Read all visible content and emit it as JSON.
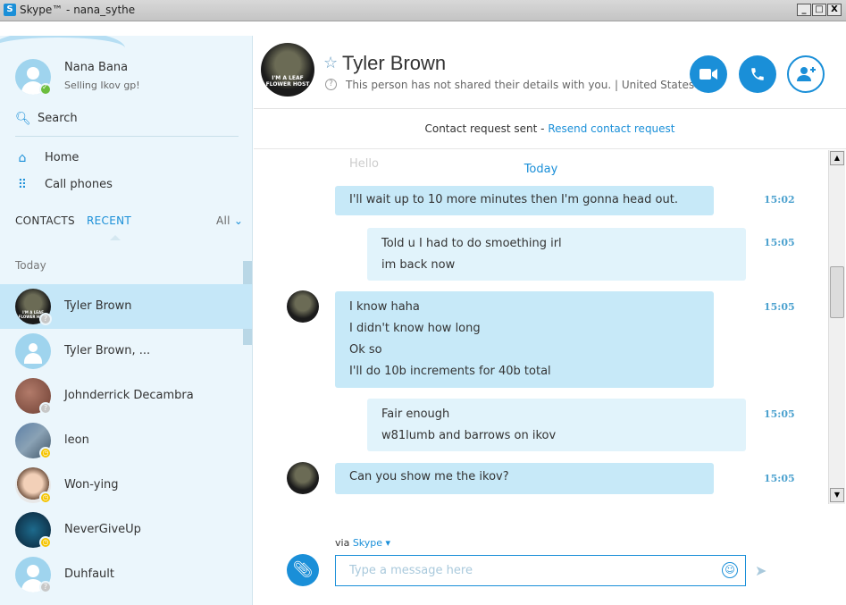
{
  "window": {
    "title": "Skype™ - nana_sythe",
    "logo": "S",
    "buttons": {
      "minimize": "_",
      "maximize": "□",
      "close": "X"
    }
  },
  "profile": {
    "name": "Nana Bana",
    "mood": "Selling Ikov gp!",
    "status_color": "#6cbd3d"
  },
  "sidebar": {
    "search_label": "Search",
    "nav": [
      {
        "label": "Home",
        "icon": "home-icon",
        "glyph": "⌂"
      },
      {
        "label": "Call phones",
        "icon": "dialpad-icon",
        "glyph": "⠿"
      }
    ],
    "tabs": {
      "contacts": "CONTACTS",
      "recent": "RECENT",
      "all": "All",
      "all_chevron": "⌄"
    },
    "section": "Today",
    "recent": [
      {
        "name": "Tyler Brown",
        "status": "unknown",
        "selected": true
      },
      {
        "name": "Tyler Brown, ...",
        "status": "",
        "selected": false
      },
      {
        "name": "Johnderrick Decambra",
        "status": "unknown",
        "selected": false
      },
      {
        "name": "leon",
        "status": "away",
        "selected": false
      },
      {
        "name": "Won-ying",
        "status": "away",
        "selected": false
      },
      {
        "name": "NeverGiveUp",
        "status": "away",
        "selected": false
      },
      {
        "name": "Duhfault",
        "status": "unknown",
        "selected": false
      }
    ]
  },
  "header": {
    "contact_name": "Tyler Brown",
    "info": "This person has not shared their details with you.  |  United States",
    "avatar_caption": "I'M A LEAF FLOWER HOST",
    "buttons": {
      "video": "video-call-icon",
      "call": "phone-icon",
      "add": "add-contact-icon"
    }
  },
  "request_bar": {
    "text": "Contact request sent - ",
    "link": "Resend contact request"
  },
  "chat": {
    "faded_text": "Hello",
    "date_separator": "Today",
    "messages": [
      {
        "dir": "in",
        "lines": [
          "I'll wait up to 10 more minutes then I'm gonna head out."
        ],
        "time": "15:02"
      },
      {
        "dir": "out",
        "lines": [
          "Told u I had to do smoething irl",
          "im back now"
        ],
        "time": "15:05"
      },
      {
        "dir": "in",
        "lines": [
          "I know haha",
          "I didn't know how long",
          "Ok so",
          "I'll do 10b increments for 40b total"
        ],
        "time": "15:05"
      },
      {
        "dir": "out",
        "lines": [
          "Fair enough",
          "w81lumb and barrows on ikov"
        ],
        "time": "15:05"
      },
      {
        "dir": "in",
        "lines": [
          "Can you show me the ikov?"
        ],
        "time": "15:05"
      }
    ]
  },
  "composer": {
    "via_prefix": "via ",
    "via_service": "Skype",
    "via_chevron": "▾",
    "placeholder": "Type a message here"
  },
  "colors": {
    "accent": "#1a8fd8",
    "sidebar_bg": "#ebf6fc",
    "selected_bg": "#c5e7f8",
    "incoming_bubble": "#c7e9f8",
    "outgoing_bubble": "#e1f3fb",
    "away": "#f5c400",
    "unknown": "#c7c7c7"
  }
}
